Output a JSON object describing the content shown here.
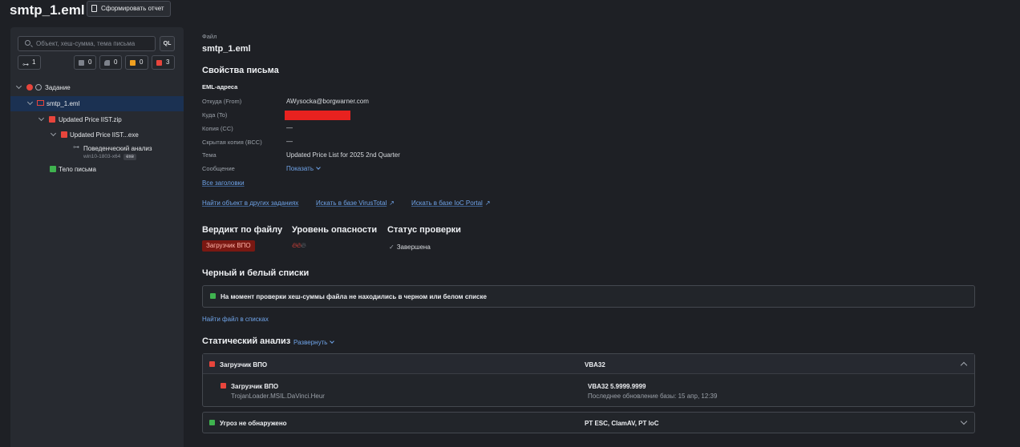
{
  "header": {
    "title": "smtp_1.eml",
    "report_button": "Сформировать отчет"
  },
  "sidebar": {
    "search_placeholder": "Объект, хеш-сумма, тема письма",
    "ql_label": "QL",
    "counters": {
      "tree": "1",
      "gray": "0",
      "gray2": "0",
      "orange": "0",
      "red": "3"
    },
    "tree": [
      {
        "label": "Задание"
      },
      {
        "label": "smtp_1.eml"
      },
      {
        "label": "Updated Price lIST.zip"
      },
      {
        "label": "Updated Price lIST...exe"
      },
      {
        "label": "Поведенческий анализ",
        "sub": "win10-1803-x64",
        "tag": "exe"
      },
      {
        "label": "Тело письма"
      }
    ]
  },
  "main": {
    "file_label": "Файл",
    "file_name": "smtp_1.eml",
    "props_title": "Свойства письма",
    "eml_title": "EML-адреса",
    "fields": [
      {
        "label": "Откуда (From)",
        "value": "AWysocka@borgwarner.com"
      },
      {
        "label": "Куда (To)",
        "value": ""
      },
      {
        "label": "Копия (CC)",
        "value": "—"
      },
      {
        "label": "Скрытая копия (BCC)",
        "value": "—"
      },
      {
        "label": "Тема",
        "value": "Updated Price List for 2025 2nd Quarter"
      },
      {
        "label": "Сообщение",
        "value": "Показать"
      }
    ],
    "all_headers": "Все заголовки",
    "links": {
      "find_other": "Найти объект в других заданиях",
      "virustotal": "Искать в базе VirusTotal",
      "ioc_portal": "Искать в базе IoC Portal"
    },
    "verdict_title": "Вердикт по файлу",
    "verdict_value": "Загрузчик ВПО",
    "danger_title": "Уровень опасности",
    "status_title": "Статус проверки",
    "status_value": "Завершена",
    "lists_title": "Черный и белый списки",
    "lists_message": "На момент проверки хеш-суммы файла не находились в черном или белом списке",
    "find_in_lists": "Найти файл в списках",
    "static_title": "Статический анализ",
    "expand_label": "Развернуть",
    "static_groups": [
      {
        "verdict": "Загрузчик ВПО",
        "engine": "VBA32",
        "detail": {
          "name": "Загрузчик ВПО",
          "signature": "TrojanLoader.MSIL.DaVinci.Heur",
          "engine_version": "VBA32 5.9999.9999",
          "db_update": "Последнее обновление базы: 15 апр, 12:39"
        }
      },
      {
        "verdict": "Угроз не обнаружено",
        "engine": "PT ESC, ClamAV, PT IoC"
      }
    ]
  },
  "colors": {
    "red": "#e8453c",
    "green": "#3fb34f",
    "orange": "#f0a020",
    "gray": "#7d828b",
    "link": "#6fa3e8",
    "selected": "#1b3152"
  }
}
